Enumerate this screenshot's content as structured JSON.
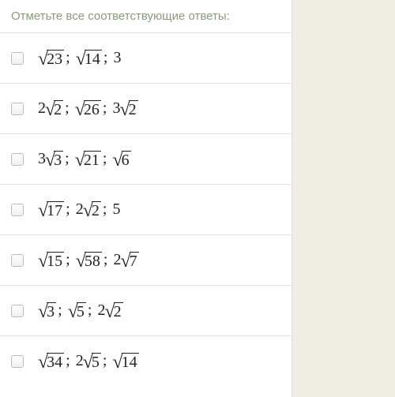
{
  "prompt": "Отметьте все соответствующие ответы:",
  "options": [
    {
      "display": "√23; √14; 3",
      "terms": [
        {
          "coef": "",
          "radicand": "23"
        },
        {
          "coef": "",
          "radicand": "14"
        },
        {
          "coef": "3",
          "radicand": ""
        }
      ]
    },
    {
      "display": "2√2; √26; 3√2",
      "terms": [
        {
          "coef": "2",
          "radicand": "2"
        },
        {
          "coef": "",
          "radicand": "26"
        },
        {
          "coef": "3",
          "radicand": "2"
        }
      ]
    },
    {
      "display": "3√3; √21; √6",
      "terms": [
        {
          "coef": "3",
          "radicand": "3"
        },
        {
          "coef": "",
          "radicand": "21"
        },
        {
          "coef": "",
          "radicand": "6"
        }
      ]
    },
    {
      "display": "√17; 2√2; 5",
      "terms": [
        {
          "coef": "",
          "radicand": "17"
        },
        {
          "coef": "2",
          "radicand": "2"
        },
        {
          "coef": "5",
          "radicand": ""
        }
      ]
    },
    {
      "display": "√15; √58; 2√7",
      "terms": [
        {
          "coef": "",
          "radicand": "15"
        },
        {
          "coef": "",
          "radicand": "58"
        },
        {
          "coef": "2",
          "radicand": "7"
        }
      ]
    },
    {
      "display": "√3; √5; 2√2",
      "terms": [
        {
          "coef": "",
          "radicand": "3"
        },
        {
          "coef": "",
          "radicand": "5"
        },
        {
          "coef": "2",
          "radicand": "2"
        }
      ]
    },
    {
      "display": "√34; 2√5; √14",
      "terms": [
        {
          "coef": "",
          "radicand": "34"
        },
        {
          "coef": "2",
          "radicand": "5"
        },
        {
          "coef": "",
          "radicand": "14"
        }
      ]
    }
  ]
}
